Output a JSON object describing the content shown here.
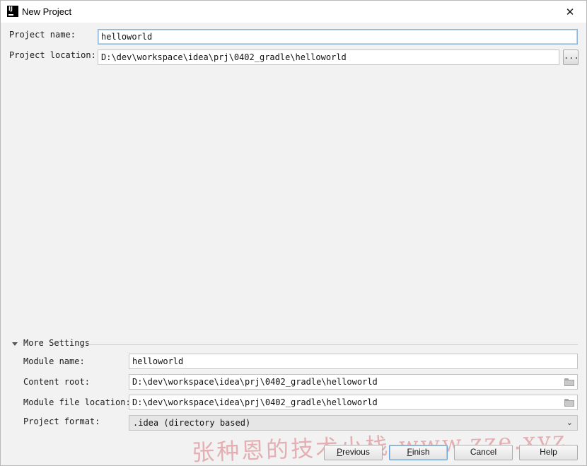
{
  "window": {
    "title": "New Project",
    "close_glyph": "✕"
  },
  "project": {
    "name_label": "Project name:",
    "name_value": "helloworld",
    "location_label": "Project location:",
    "location_value": "D:\\dev\\workspace\\idea\\prj\\0402_gradle\\helloworld",
    "browse_label": "..."
  },
  "more_settings": {
    "header": "More Settings",
    "module_name_label": "Module name:",
    "module_name_value": "helloworld",
    "content_root_label": "Content root:",
    "content_root_value": "D:\\dev\\workspace\\idea\\prj\\0402_gradle\\helloworld",
    "module_file_label": "Module file location:",
    "module_file_value": "D:\\dev\\workspace\\idea\\prj\\0402_gradle\\helloworld",
    "format_label": "Project format:",
    "format_value": ".idea (directory based)"
  },
  "buttons": {
    "previous_mn": "P",
    "previous_rest": "revious",
    "finish_mn": "F",
    "finish_rest": "inish",
    "cancel": "Cancel",
    "help": "Help"
  },
  "watermark": "张种恩的技术小栈 www.zze.xyz",
  "icons": {
    "app": "intellij-icon",
    "folder": "folder-icon",
    "chevron": "chevron-down-icon"
  }
}
